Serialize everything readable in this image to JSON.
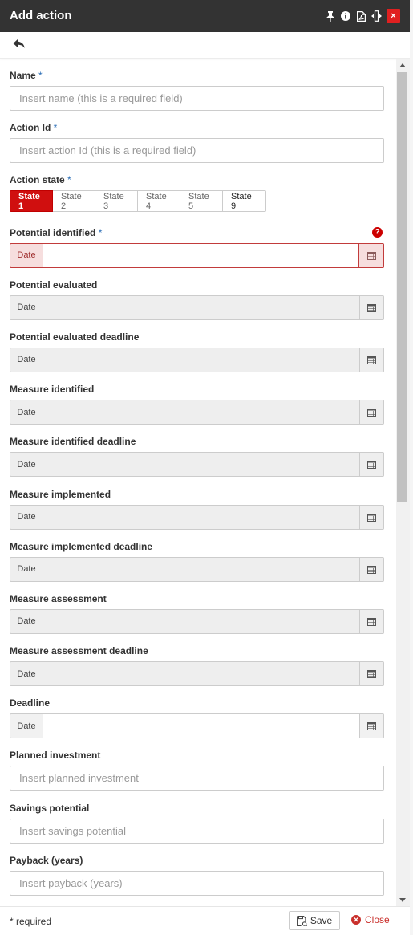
{
  "window": {
    "title": "Add action",
    "icons": [
      "pin-icon",
      "info-icon",
      "pdf-icon",
      "resize-icon",
      "close-icon"
    ],
    "close_glyph": "×"
  },
  "toolbar": {
    "back_icon": "reply-arrow-icon"
  },
  "form": {
    "name": {
      "label": "Name",
      "required_mark": "*",
      "placeholder": "Insert name (this is a required field)"
    },
    "action_id": {
      "label": "Action Id",
      "required_mark": "*",
      "placeholder": "Insert action Id (this is a required field)"
    },
    "action_state": {
      "label": "Action state",
      "required_mark": "*",
      "states": [
        "State 1",
        "State 2",
        "State 3",
        "State 4",
        "State 5",
        "State 9"
      ],
      "selected": "State 1"
    },
    "potential_identified": {
      "label": "Potential identified",
      "required_mark": "*",
      "addon": "Date",
      "help_glyph": "?"
    },
    "potential_evaluated": {
      "label": "Potential evaluated",
      "addon": "Date"
    },
    "potential_evaluated_deadline": {
      "label": "Potential evaluated deadline",
      "addon": "Date"
    },
    "measure_identified": {
      "label": "Measure identified",
      "addon": "Date"
    },
    "measure_identified_deadline": {
      "label": "Measure identified deadline",
      "addon": "Date"
    },
    "measure_implemented": {
      "label": "Measure implemented",
      "addon": "Date"
    },
    "measure_implemented_deadline": {
      "label": "Measure implemented deadline",
      "addon": "Date"
    },
    "measure_assessment": {
      "label": "Measure assessment",
      "addon": "Date"
    },
    "measure_assessment_deadline": {
      "label": "Measure assessment deadline",
      "addon": "Date"
    },
    "deadline": {
      "label": "Deadline",
      "addon": "Date"
    },
    "planned_investment": {
      "label": "Planned investment",
      "placeholder": "Insert planned investment"
    },
    "savings_potential": {
      "label": "Savings potential",
      "placeholder": "Insert savings potential"
    },
    "payback": {
      "label": "Payback (years)",
      "placeholder": "Insert payback (years)"
    }
  },
  "footer": {
    "required_note": "* required",
    "save_label": "Save",
    "close_label": "Close"
  },
  "colors": {
    "titlebar": "#333333",
    "accent_red": "#d00f0f",
    "required_blue": "#2a6db5"
  }
}
